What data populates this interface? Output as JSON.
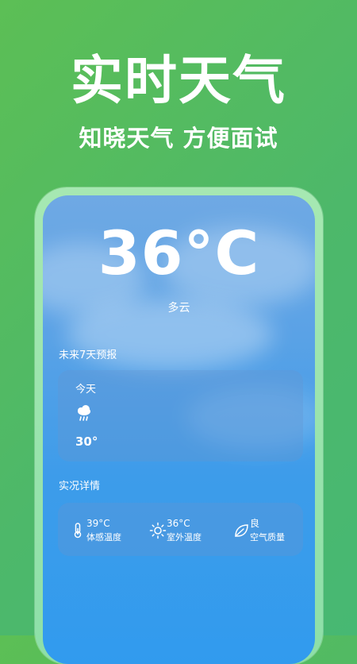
{
  "promo": {
    "title": "实时天气",
    "subtitle": "知晓天气 方便面试"
  },
  "weather": {
    "temperature": "36°C",
    "condition": "多云"
  },
  "forecast": {
    "section_title": "未来7天预报",
    "days": [
      {
        "day": "今天",
        "icon": "rain-cloud-icon",
        "temp": "30°"
      }
    ]
  },
  "details": {
    "section_title": "实况详情",
    "items": [
      {
        "value": "39°C",
        "label": "体感温度",
        "icon": "thermometer-icon"
      },
      {
        "value": "36°C",
        "label": "室外温度",
        "icon": "sun-icon"
      },
      {
        "value": "良",
        "label": "空气质量",
        "icon": "leaf-icon"
      }
    ]
  },
  "colors": {
    "background": "#4db86a",
    "sky": "#3d9cea",
    "text": "#ffffff"
  }
}
